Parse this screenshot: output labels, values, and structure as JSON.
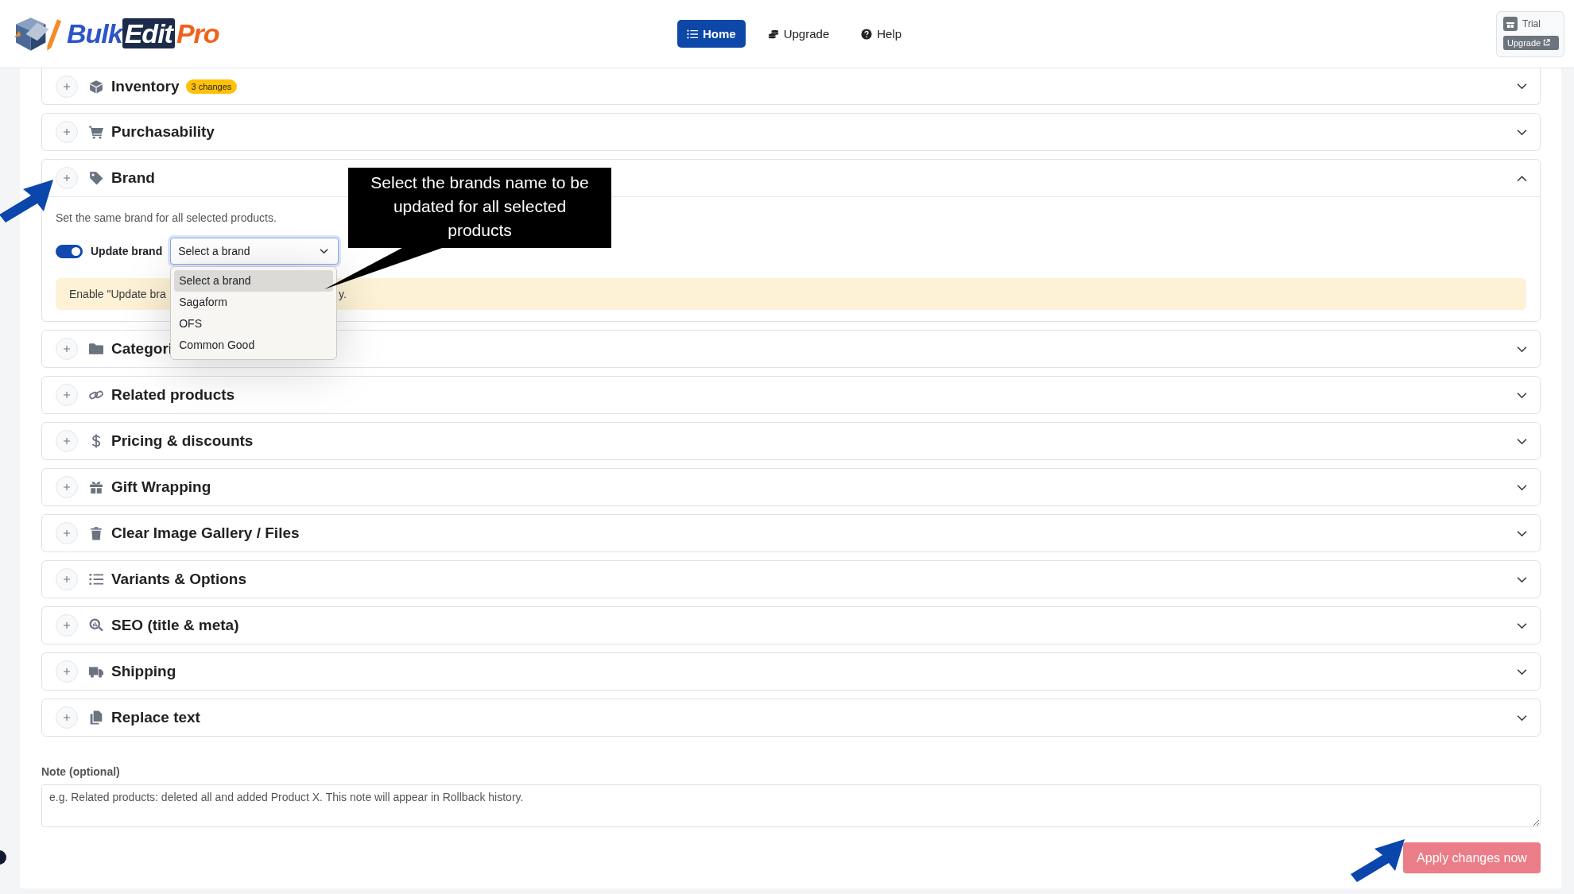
{
  "header": {
    "logo": [
      "Bulk",
      "Edit",
      "Pro"
    ],
    "nav": [
      {
        "label": "Home",
        "selected": true
      },
      {
        "label": "Upgrade",
        "selected": false
      },
      {
        "label": "Help",
        "selected": false
      }
    ],
    "plan": {
      "label": "Trial",
      "button": "Upgrade"
    }
  },
  "sections": [
    {
      "title": "Inventory",
      "badge": "3 changes",
      "expanded": false
    },
    {
      "title": "Purchasability",
      "expanded": false
    },
    {
      "title": "Brand",
      "expanded": true
    },
    {
      "title": "Categori",
      "expanded": false
    },
    {
      "title": "Related products",
      "expanded": false
    },
    {
      "title": "Pricing & discounts",
      "expanded": false
    },
    {
      "title": "Gift Wrapping",
      "expanded": false
    },
    {
      "title": "Clear Image Gallery / Files",
      "expanded": false
    },
    {
      "title": "Variants & Options",
      "expanded": false
    },
    {
      "title": "SEO (title & meta)",
      "expanded": false
    },
    {
      "title": "Shipping",
      "expanded": false
    },
    {
      "title": "Replace text",
      "expanded": false
    }
  ],
  "brand": {
    "description": "Set the same brand for all selected products.",
    "toggle": {
      "label": "Update brand",
      "on": true
    },
    "select": {
      "value": "Select a brand",
      "open": true,
      "options": [
        {
          "label": "Select a brand",
          "selected": true
        },
        {
          "label": "Sagaform",
          "selected": false
        },
        {
          "label": "OFS",
          "selected": false
        },
        {
          "label": "Common Good",
          "selected": false
        }
      ]
    },
    "alert": [
      "Enable \"Update bra",
      "y."
    ],
    "callout": "Select the brands name to be updated for all selected products"
  },
  "note": {
    "label": "Note (optional)",
    "placeholder": "e.g. Related products: deleted all and added Product X. This note will appear in Rollback history."
  },
  "apply": {
    "label": "Apply changes now",
    "disabled": true
  }
}
